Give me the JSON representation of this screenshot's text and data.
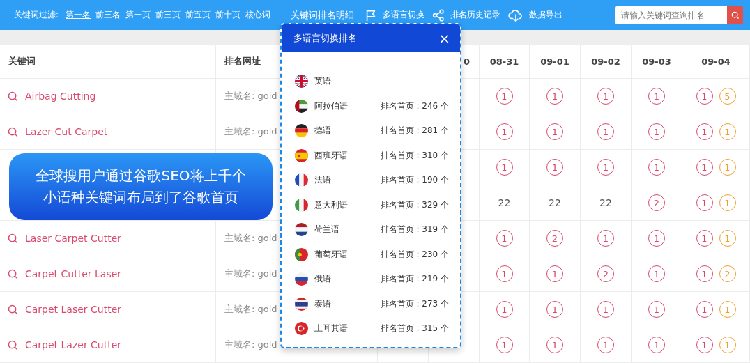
{
  "top_bar": {
    "filter_label": "关键词过滤:",
    "filters": [
      {
        "label": "第一名",
        "selected": true
      },
      {
        "label": "前三名",
        "selected": false
      },
      {
        "label": "第一页",
        "selected": false
      },
      {
        "label": "前三页",
        "selected": false
      },
      {
        "label": "前五页",
        "selected": false
      },
      {
        "label": "前十页",
        "selected": false
      },
      {
        "label": "核心词",
        "selected": false
      }
    ],
    "title": "关键词排名明细",
    "actions": [
      {
        "kind": "flag",
        "label": "多语言切换"
      },
      {
        "kind": "share",
        "label": "排名历史记录"
      },
      {
        "kind": "download",
        "label": "数据导出"
      }
    ],
    "search": {
      "placeholder": "请输入关键词查询排名"
    }
  },
  "table": {
    "columns": [
      {
        "label": "关键词"
      },
      {
        "label": "排名网址"
      },
      {
        "label": "0"
      },
      {
        "label": "08-31"
      },
      {
        "label": "09-01"
      },
      {
        "label": "09-02"
      },
      {
        "label": "09-03"
      },
      {
        "label": "09-04"
      }
    ],
    "rows": [
      {
        "keyword": "Airbag Cutting",
        "url": "主域名: gold",
        "ranks": [
          [
            {
              "text": "1",
              "kind": "circle",
              "color": "#d94a6e"
            }
          ],
          [
            {
              "text": "1",
              "kind": "circle",
              "color": "#d94a6e"
            }
          ],
          [
            {
              "text": "1",
              "kind": "circle",
              "color": "#d94a6e"
            }
          ],
          [
            {
              "text": "1",
              "kind": "circle",
              "color": "#d94a6e"
            }
          ],
          [
            {
              "text": "1",
              "kind": "circle",
              "color": "#d94a6e"
            },
            {
              "text": "5",
              "kind": "circle",
              "color": "#efa12e"
            }
          ]
        ]
      },
      {
        "keyword": "Lazer Cut Carpet",
        "url": "主域名: gold",
        "ranks": [
          [
            {
              "text": "1",
              "kind": "circle",
              "color": "#d94a6e"
            }
          ],
          [
            {
              "text": "1",
              "kind": "circle",
              "color": "#d94a6e"
            }
          ],
          [
            {
              "text": "1",
              "kind": "circle",
              "color": "#d94a6e"
            }
          ],
          [
            {
              "text": "1",
              "kind": "circle",
              "color": "#d94a6e"
            }
          ],
          [
            {
              "text": "1",
              "kind": "circle",
              "color": "#d94a6e"
            },
            {
              "text": "1",
              "kind": "circle",
              "color": "#efa12e"
            }
          ]
        ]
      },
      {
        "ranks": [
          [
            {
              "text": "1",
              "kind": "circle",
              "color": "#d94a6e"
            }
          ],
          [
            {
              "text": "1",
              "kind": "circle",
              "color": "#d94a6e"
            }
          ],
          [
            {
              "text": "1",
              "kind": "circle",
              "color": "#d94a6e"
            }
          ],
          [
            {
              "text": "1",
              "kind": "circle",
              "color": "#d94a6e"
            }
          ],
          [
            {
              "text": "1",
              "kind": "circle",
              "color": "#d94a6e"
            },
            {
              "text": "1",
              "kind": "circle",
              "color": "#efa12e"
            }
          ]
        ]
      },
      {
        "ranks": [
          [
            {
              "text": "22",
              "kind": "plain"
            }
          ],
          [
            {
              "text": "22",
              "kind": "plain"
            }
          ],
          [
            {
              "text": "22",
              "kind": "plain"
            }
          ],
          [
            {
              "text": "2",
              "kind": "circle",
              "color": "#d94a6e"
            }
          ],
          [
            {
              "text": "1",
              "kind": "circle",
              "color": "#d94a6e"
            },
            {
              "text": "1",
              "kind": "circle",
              "color": "#efa12e"
            }
          ]
        ]
      },
      {
        "keyword": "Laser Carpet Cutter",
        "url": "主域名: gold",
        "ranks": [
          [
            {
              "text": "1",
              "kind": "circle",
              "color": "#d94a6e"
            }
          ],
          [
            {
              "text": "2",
              "kind": "circle",
              "color": "#d94a6e"
            }
          ],
          [
            {
              "text": "1",
              "kind": "circle",
              "color": "#d94a6e"
            }
          ],
          [
            {
              "text": "1",
              "kind": "circle",
              "color": "#d94a6e"
            }
          ],
          [
            {
              "text": "1",
              "kind": "circle",
              "color": "#d94a6e"
            },
            {
              "text": "1",
              "kind": "circle",
              "color": "#efa12e"
            }
          ]
        ]
      },
      {
        "keyword": "Carpet Cutter Laser",
        "url": "主域名: gold",
        "ranks": [
          [
            {
              "text": "1",
              "kind": "circle",
              "color": "#d94a6e"
            }
          ],
          [
            {
              "text": "1",
              "kind": "circle",
              "color": "#d94a6e"
            }
          ],
          [
            {
              "text": "2",
              "kind": "circle",
              "color": "#d94a6e"
            }
          ],
          [
            {
              "text": "1",
              "kind": "circle",
              "color": "#d94a6e"
            }
          ],
          [
            {
              "text": "1",
              "kind": "circle",
              "color": "#d94a6e"
            },
            {
              "text": "2",
              "kind": "circle",
              "color": "#efa12e"
            }
          ]
        ]
      },
      {
        "keyword": "Carpet Laser Cutter",
        "url": "主域名: gold",
        "ranks": [
          [
            {
              "text": "1",
              "kind": "circle",
              "color": "#d94a6e"
            }
          ],
          [
            {
              "text": "1",
              "kind": "circle",
              "color": "#d94a6e"
            }
          ],
          [
            {
              "text": "1",
              "kind": "circle",
              "color": "#d94a6e"
            }
          ],
          [
            {
              "text": "1",
              "kind": "circle",
              "color": "#d94a6e"
            }
          ],
          [
            {
              "text": "1",
              "kind": "circle",
              "color": "#d94a6e"
            },
            {
              "text": "1",
              "kind": "circle",
              "color": "#efa12e"
            }
          ]
        ]
      },
      {
        "keyword": "Carpet Lazer Cutter",
        "url": "主域名: gold",
        "ranks": [
          [
            {
              "text": "1",
              "kind": "circle",
              "color": "#d94a6e"
            }
          ],
          [
            {
              "text": "1",
              "kind": "circle",
              "color": "#d94a6e"
            }
          ],
          [
            {
              "text": "1",
              "kind": "circle",
              "color": "#d94a6e"
            }
          ],
          [
            {
              "text": "1",
              "kind": "circle",
              "color": "#d94a6e"
            }
          ],
          [
            {
              "text": "1",
              "kind": "circle",
              "color": "#d94a6e"
            },
            {
              "text": "1",
              "kind": "circle",
              "color": "#efa12e"
            }
          ]
        ]
      }
    ]
  },
  "banner": {
    "lines": [
      "全球搜用户通过谷歌SEO将上千个",
      "小语种关键词布局到了谷歌首页"
    ]
  },
  "dialog": {
    "title": "多语言切换排名",
    "close": "×",
    "languages": [
      {
        "kind": "uk",
        "name": "英语"
      },
      {
        "kind": "ae",
        "name": "阿拉伯语",
        "count": "排名首页 : 246 个"
      },
      {
        "kind": "de",
        "name": "德语",
        "count": "排名首页 : 281 个"
      },
      {
        "kind": "es",
        "name": "西班牙语",
        "count": "排名首页 : 310 个"
      },
      {
        "kind": "fr",
        "name": "法语",
        "count": "排名首页 : 190 个"
      },
      {
        "kind": "it",
        "name": "意大利语",
        "count": "排名首页 : 329 个"
      },
      {
        "kind": "nl",
        "name": "荷兰语",
        "count": "排名首页 : 319 个"
      },
      {
        "kind": "pt",
        "name": "葡萄牙语",
        "count": "排名首页 : 230 个"
      },
      {
        "kind": "ru",
        "name": "俄语",
        "count": "排名首页 : 219 个"
      },
      {
        "kind": "th",
        "name": "泰语",
        "count": "排名首页 : 273 个"
      },
      {
        "kind": "tr",
        "name": "土耳其语",
        "count": "排名首页 : 315 个"
      }
    ]
  }
}
